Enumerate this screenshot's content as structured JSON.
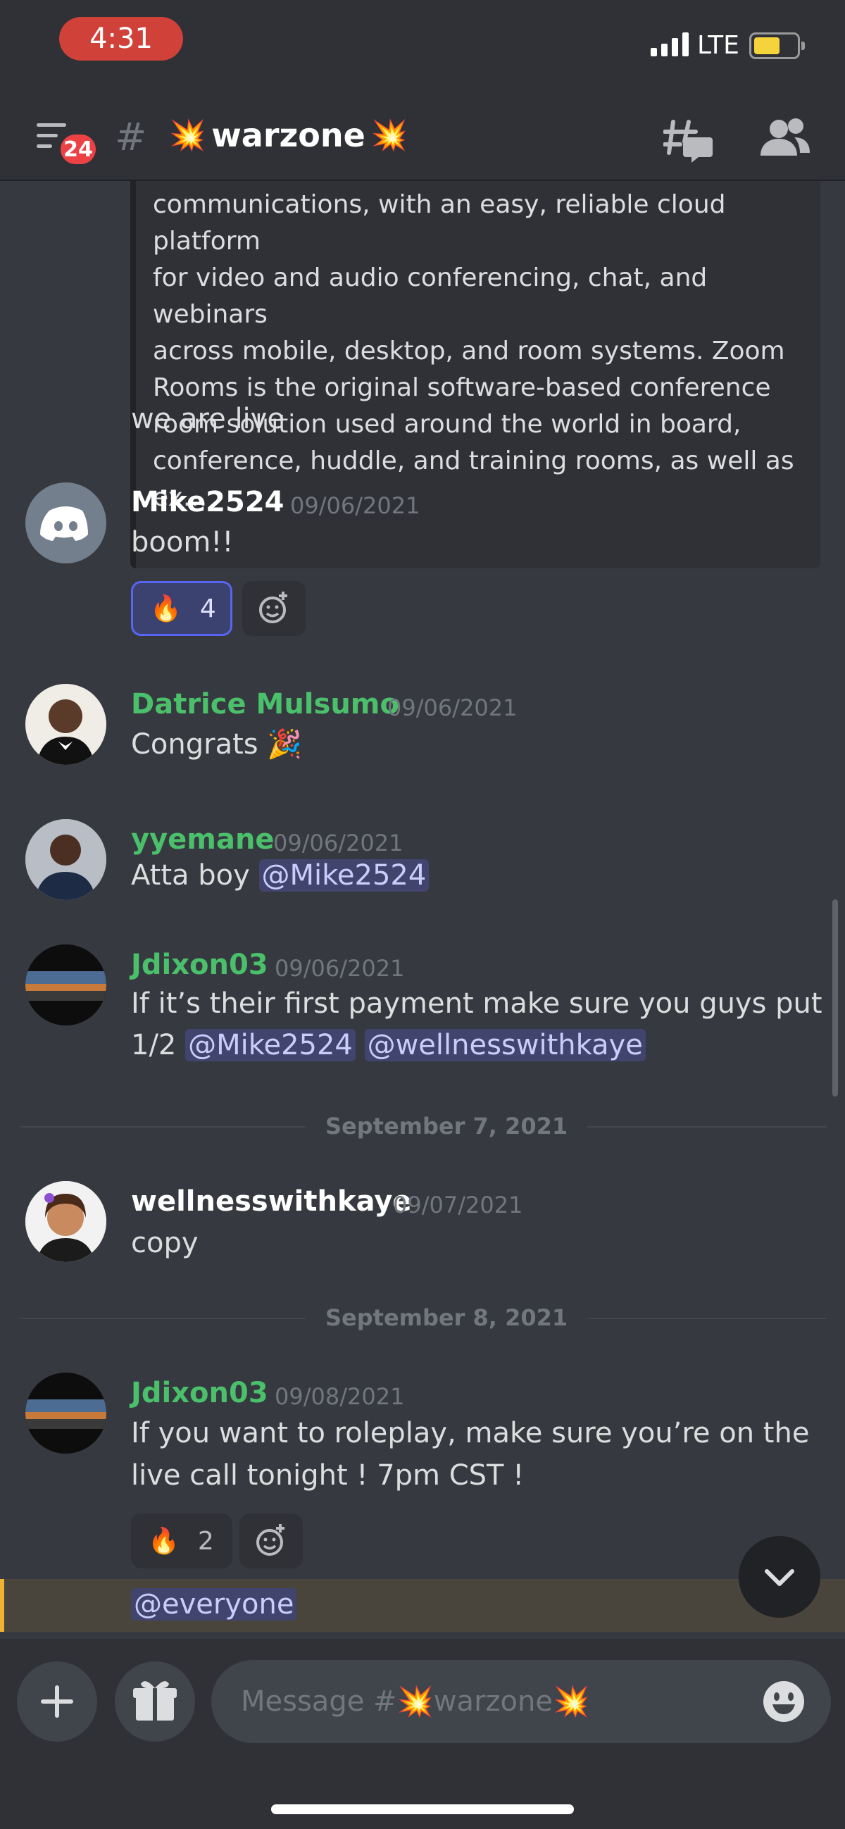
{
  "status_bar": {
    "time": "4:31",
    "network": "LTE"
  },
  "header": {
    "unread_badge": "24",
    "hash": "#",
    "channel_name": "warzone",
    "channel_emoji": "💥"
  },
  "embed": {
    "lines": [
      "communications, with an easy, reliable cloud platform",
      "for video and audio conferencing, chat, and webinars",
      "across mobile, desktop, and room systems. Zoom",
      "Rooms is the original software-based conference",
      "room solution used around the world in board,",
      "conference, huddle, and training rooms, as well as ex..."
    ]
  },
  "messages": [
    {
      "text": "we are live"
    },
    {
      "author": "Mike2524",
      "timestamp": "09/06/2021",
      "text": "boom!!",
      "reactions": [
        {
          "emoji": "🔥",
          "count": "4"
        }
      ]
    },
    {
      "author": "Datrice Mulsumo",
      "timestamp": "09/06/2021",
      "text": "Congrats",
      "emoji": "🎉"
    },
    {
      "author": "yyemane",
      "timestamp": "09/06/2021",
      "text": "Atta boy",
      "mentions": [
        "@Mike2524"
      ]
    },
    {
      "author": "Jdixon03",
      "timestamp": "09/06/2021",
      "text_line1": "If it’s their first payment make sure you guys put",
      "text_line2": "1/2",
      "mentions": [
        "@Mike2524",
        "@wellnesswithkaye"
      ]
    },
    {
      "author": "wellnesswithkaye",
      "timestamp": "09/07/2021",
      "text": "copy"
    },
    {
      "author": "Jdixon03",
      "timestamp": "09/08/2021",
      "text_line1": "If you want to roleplay, make sure you’re on the",
      "text_line2": "live call tonight ! 7pm CST !",
      "reactions": [
        {
          "emoji": "🔥",
          "count": "2"
        }
      ]
    },
    {
      "mention_text": "@everyone"
    }
  ],
  "dividers": [
    "September 7, 2021",
    "September 8, 2021"
  ],
  "composer": {
    "placeholder_prefix": "Message #",
    "placeholder_channel": "warzone",
    "placeholder_emoji": "💥"
  },
  "colors": {
    "accent": "#5865f2",
    "username_green": "#4bc06b",
    "background": "#36393f",
    "mention_bg": "#41456d",
    "badge_red": "#ed4245",
    "highlight_bar": "#f0b232"
  },
  "icons": [
    "hamburger-icon",
    "threads-icon",
    "members-icon",
    "discord-logo-icon",
    "add-reaction-icon",
    "plus-icon",
    "gift-icon",
    "emoji-picker-icon",
    "chevron-down-icon"
  ]
}
